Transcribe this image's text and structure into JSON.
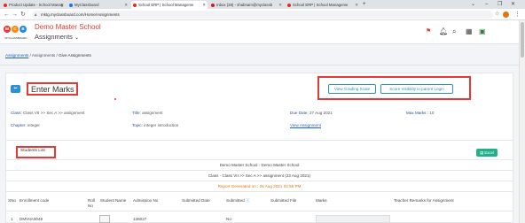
{
  "browser": {
    "tabs": [
      {
        "label": "Product Update - School Manag",
        "color": "#d93025"
      },
      {
        "label": "MyClassboard",
        "color": "#1a73e8"
      },
      {
        "label": "School ERP | School Manageme",
        "color": "#d93025"
      },
      {
        "label": "Inbox (28) - shabnam@myclassb",
        "color": "#c5221f"
      },
      {
        "label": "School ERP | School Manageme",
        "color": "#d93025"
      }
    ],
    "new_tab": "+",
    "url": "mktg.myclassboard.com/Home/Assignments"
  },
  "header": {
    "logo_text": "MYCLASSBOARD",
    "school_name": "Demo Master School",
    "module": "Assignments",
    "module_chevron": "chevron-down-icon",
    "icons": [
      "flag-icon",
      "bell-icon",
      "search-icon",
      "grid-icon",
      "monitor-icon"
    ]
  },
  "breadcrumb": {
    "item1": "Assignments",
    "sep": "/",
    "item2": "Assignments",
    "item3": "Give Assignments"
  },
  "page": {
    "back_icon": "arrow-left-icon",
    "title": "Enter Marks",
    "view_grading_scale": "View Grading Scale",
    "score_visibility": "Score Visibility in parent Login"
  },
  "details": {
    "class_label": "Class:",
    "class_value": "Class VII >> Sec A >> assignment",
    "title_label": "Title:",
    "title_value": "assignment",
    "due_label": "Due Date:",
    "due_value": "27 Aug 2021",
    "max_label": "Max Marks :",
    "max_value": "10",
    "chapter_label": "Chapter:",
    "chapter_value": "integer",
    "topic_label": "Topic:",
    "topic_value": "integer introduction",
    "view_assignment": "View Assignment"
  },
  "students": {
    "title": "Students List",
    "excel_label": "Excel",
    "report_lines": [
      "Demo Master School - Demo Master School",
      "Class - Class VII >> Sec A >> assignment (23 Aug 2021)",
      "Report Generated on : 26 Aug 2021 04:55 PM"
    ],
    "columns": [
      "SNo",
      "Enrollment code",
      "Roll No",
      "Student Name",
      "Admission No",
      "Submitted Date",
      "Submitted",
      "Submitted File",
      "Marks",
      "Teacher Remarks for Assignment"
    ],
    "rows": [
      {
        "sno": "1",
        "enrollment": "DMVIIA0049",
        "admission": "136027",
        "submitted": "No"
      }
    ]
  }
}
